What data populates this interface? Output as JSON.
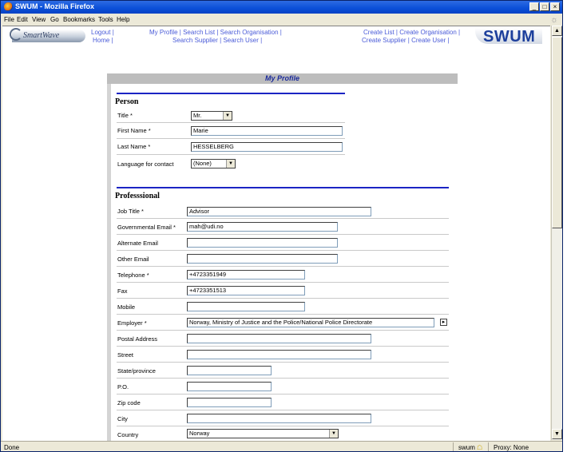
{
  "window": {
    "title": "SWUM - Mozilla Firefox",
    "buttons": {
      "minimize": "_",
      "maximize": "□",
      "close": "×"
    }
  },
  "menu": [
    "File",
    "Edit",
    "View",
    "Go",
    "Bookmarks",
    "Tools",
    "Help"
  ],
  "header": {
    "logo_left": "SmartWave",
    "logo_right": "SWUM",
    "nav_left": [
      "Logout |",
      "Home |"
    ],
    "nav_middle_1": "My Profile | Search List | Search Organisation |",
    "nav_middle_2": "Search Supplier | Search User |",
    "nav_right_1": "Create List | Create Organisation |",
    "nav_right_2": "Create Supplier | Create User |"
  },
  "page": {
    "section_title": "My Profile",
    "person": {
      "heading": "Person",
      "title_label": "Title *",
      "title_value": "Mr.",
      "first_name_label": "First Name *",
      "first_name_value": "Marie",
      "last_name_label": "Last Name *",
      "last_name_value": "HESSELBERG",
      "language_label": "Language for contact",
      "language_value": "(None)"
    },
    "professional": {
      "heading": "Professsional",
      "job_title_label": "Job Title *",
      "job_title_value": "Advisor",
      "gov_email_label": "Governmental Email *",
      "gov_email_value": "mah@udi.no",
      "alt_email_label": "Alternate Email",
      "alt_email_value": "",
      "other_email_label": "Other Email",
      "other_email_value": "",
      "telephone_label": "Telephone *",
      "telephone_value": "+4723351949",
      "fax_label": "Fax",
      "fax_value": "+4723351513",
      "mobile_label": "Mobile",
      "mobile_value": "",
      "employer_label": "Employer *",
      "employer_value": "Norway, Ministry of Justice and the Police/National Police Directorate",
      "postal_label": "Postal Address",
      "street_label": "Street",
      "state_label": "State/province",
      "po_label": "P.O.",
      "zip_label": "Zip code",
      "city_label": "City",
      "country_label": "Country",
      "country_value": "Norway"
    }
  },
  "status": {
    "left": "Done",
    "site": "swum",
    "proxy": "Proxy: None"
  },
  "colors": {
    "title_gradient": "#0a4fd8",
    "chrome": "#ece9d8",
    "link": "#4a5bd8",
    "section_title_text": "#1b2a9a",
    "blue_rule": "#1b24c4"
  }
}
